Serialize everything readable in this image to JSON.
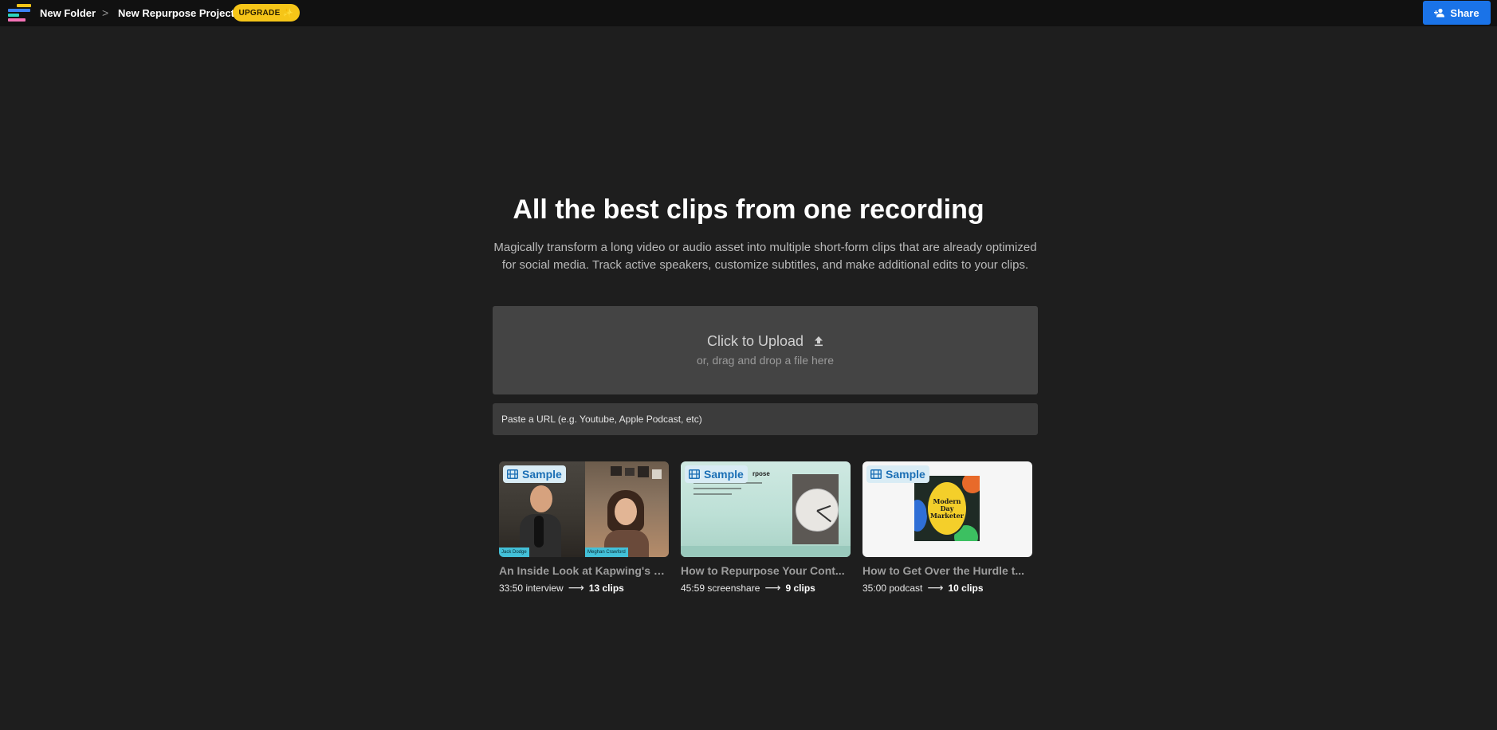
{
  "header": {
    "folder": "New Folder",
    "separator": ">",
    "project": "New Repurpose Project",
    "upgrade_label": "UPGRADE",
    "upgrade_icon": "sparkle-icon",
    "share_label": "Share",
    "share_icon": "add-person-icon"
  },
  "colors": {
    "background": "#1e1e1e",
    "topbar": "#111111",
    "upgrade": "#f5c518",
    "share": "#1a73e8",
    "upload_panel": "#444444",
    "badge_text": "#1b6fb5"
  },
  "hero": {
    "title": "All the best clips from one recording",
    "subtitle_line1": "Magically transform a long video or audio asset into multiple short-form clips that are already optimized",
    "subtitle_line2": "for social media. Track active speakers, customize subtitles, and make additional edits to your clips."
  },
  "upload": {
    "title": "Click to Upload",
    "icon": "upload-icon",
    "subtitle": "or, drag and drop a file here"
  },
  "url_input": {
    "placeholder": "Paste a URL (e.g. Youtube, Apple Podcast, etc)",
    "value": ""
  },
  "samples": [
    {
      "badge": "Sample",
      "title": "An Inside Look at Kapwing's B...",
      "meta": "33:50 interview",
      "arrow": "⟶",
      "clips": "13 clips",
      "names": [
        "Jack Dodge",
        "Meghan Crawford"
      ]
    },
    {
      "badge": "Sample",
      "title": "How to Repurpose Your Cont...",
      "meta": "45:59 screenshare",
      "arrow": "⟶",
      "clips": "9 clips",
      "slide_heading": "rpose"
    },
    {
      "badge": "Sample",
      "title": "How to Get Over the Hurdle t...",
      "meta": "35:00 podcast",
      "arrow": "⟶",
      "clips": "10 clips",
      "cover_text": [
        "Modern",
        "Day",
        "Marketer"
      ]
    }
  ]
}
